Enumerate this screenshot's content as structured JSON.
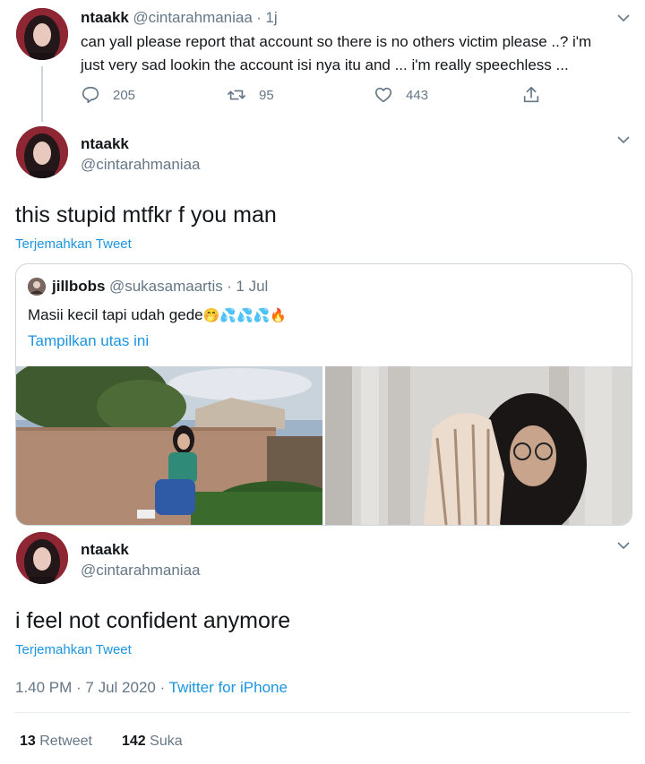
{
  "tweet1": {
    "name": "ntaakk",
    "handle": "@cintarahmaniaa",
    "sep": "·",
    "time": "1j",
    "line1": "can yall please report that account so there is no others victim please ..? i'm",
    "line2": "just very sad lookin the account isi nya itu and ... i'm really speechless ...",
    "replies": "205",
    "retweets": "95",
    "likes": "443"
  },
  "tweet2": {
    "name": "ntaakk",
    "handle": "@cintarahmaniaa",
    "text": "this stupid mtfkr f you man",
    "translate": "Terjemahkan Tweet"
  },
  "quote": {
    "name": "jillbobs",
    "handle": "@sukasamaartis",
    "sep": "·",
    "date": "1 Jul",
    "text": "Masii kecil tapi udah gede",
    "emojis": "🤭💦💦💦🔥",
    "thread_link": "Tampilkan utas ini"
  },
  "tweet3": {
    "name": "ntaakk",
    "handle": "@cintarahmaniaa",
    "text": "i feel not confident anymore",
    "translate": "Terjemahkan Tweet",
    "timestamp": "1.40 PM · 7 Jul 2020 · ",
    "source": "Twitter for iPhone",
    "retweet_count": "13",
    "retweet_label": "Retweet",
    "like_count": "142",
    "like_label": "Suka"
  },
  "colors": {
    "link": "#1b95e0",
    "secondary": "#657786",
    "text": "#14171a",
    "border": "#ccd6dd"
  }
}
